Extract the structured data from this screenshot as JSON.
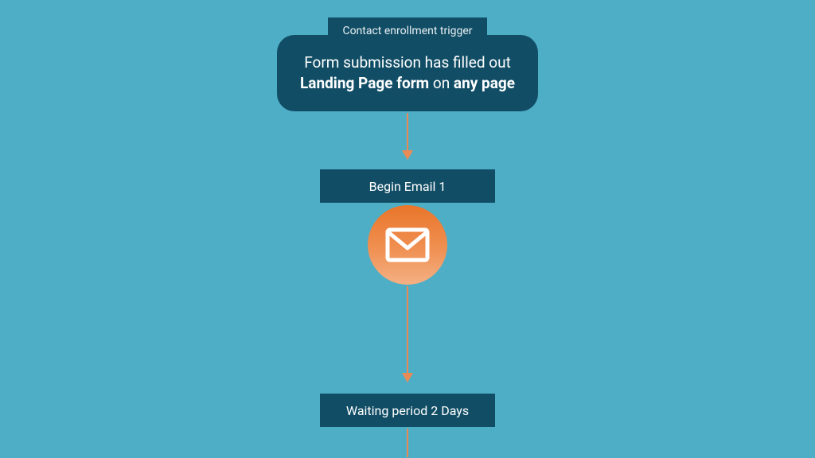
{
  "colors": {
    "background": "#4eaec6",
    "box_fill": "#114e66",
    "accent": "#e98b55",
    "text_light": "#ffffff"
  },
  "trigger": {
    "tag_label": "Contact enrollment trigger",
    "description_prefix": "Form submission has filled out",
    "description_bold1": "Landing Page form",
    "description_mid": " on ",
    "description_bold2": "any page"
  },
  "steps": {
    "email1_label": "Begin Email 1",
    "wait_label": "Waiting period 2 Days"
  },
  "icon": {
    "name": "mail-icon"
  }
}
